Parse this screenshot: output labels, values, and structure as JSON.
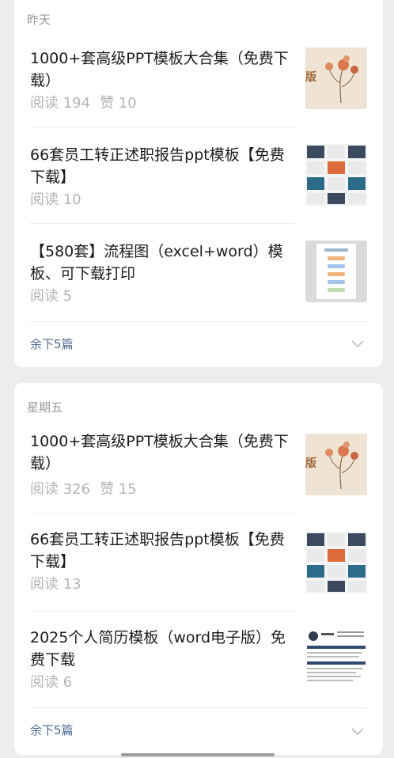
{
  "sections": [
    {
      "label": "昨天",
      "articles": [
        {
          "title": "1000+套高级PPT模板大合集（免费下载）",
          "reads": "阅读 194",
          "likes": "赞 10",
          "thumb": "floral-template-thumbnail"
        },
        {
          "title": "66套员工转正述职报告ppt模板【免费下载】",
          "reads": "阅读 10",
          "likes": "",
          "thumb": "slides-grid-thumbnail"
        },
        {
          "title": "【580套】流程图（excel+word）模板、可下载打印",
          "reads": "阅读 5",
          "likes": "",
          "thumb": "flowchart-thumbnail"
        }
      ],
      "more": "余下5篇"
    },
    {
      "label": "星期五",
      "articles": [
        {
          "title": "1000+套高级PPT模板大合集（免费下载）",
          "reads": "阅读 326",
          "likes": "赞 15",
          "thumb": "floral-template-thumbnail"
        },
        {
          "title": "66套员工转正述职报告ppt模板【免费下载】",
          "reads": "阅读 13",
          "likes": "",
          "thumb": "slides-grid-thumbnail"
        },
        {
          "title": "2025个人简历模板（word电子版）免费下载",
          "reads": "阅读 6",
          "likes": "",
          "thumb": "resume-thumbnail"
        }
      ],
      "more": "余下5篇"
    }
  ],
  "thumb_text": {
    "floral": "版"
  },
  "colors": {
    "background": "#ededed",
    "card": "#ffffff",
    "link": "#4f6a92",
    "muted": "#b4b4b4"
  }
}
